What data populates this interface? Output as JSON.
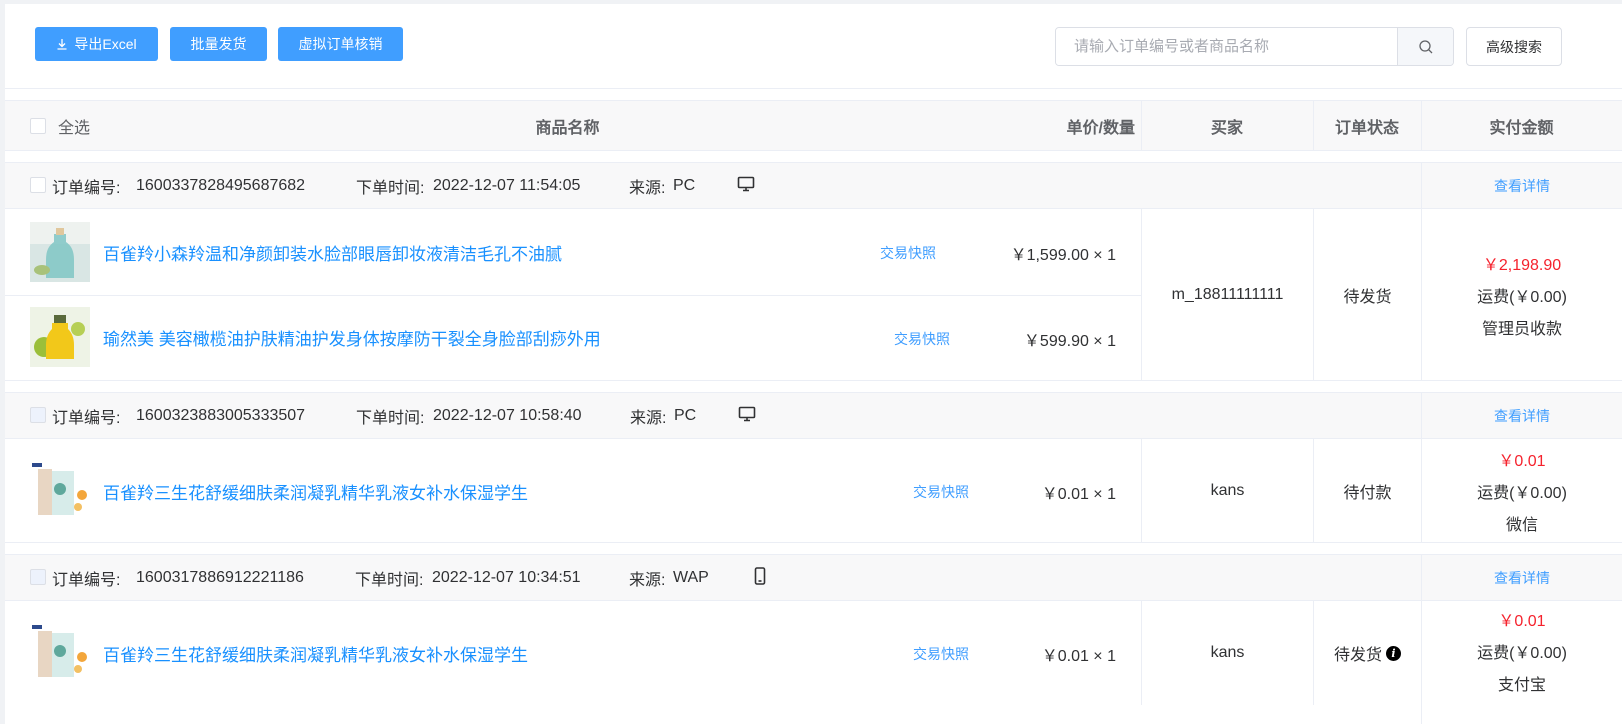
{
  "toolbar": {
    "export_label": "导出Excel",
    "batch_ship_label": "批量发货",
    "virtual_verify_label": "虚拟订单核销",
    "search_placeholder": "请输入订单编号或者商品名称",
    "advanced_search_label": "高级搜索"
  },
  "table_header": {
    "select_all": "全选",
    "product_name": "商品名称",
    "price_qty": "单价/数量",
    "buyer": "买家",
    "order_status": "订单状态",
    "paid_amount": "实付金额"
  },
  "orders": [
    {
      "order_no_label": "订单编号:",
      "order_no": "1600337828495687682",
      "time_label": "下单时间:",
      "time": "2022-12-07 11:54:05",
      "source_label": "来源:",
      "source": "PC",
      "source_icon": "desktop-icon",
      "detail_label": "查看详情",
      "buyer": "m_18811111111",
      "status": "待发货",
      "amount": "￥2,198.90",
      "shipping": "运费(￥0.00)",
      "payment": "管理员收款",
      "items": [
        {
          "name": "百雀羚小森羚温和净颜卸装水脸部眼唇卸妆液清洁毛孔不油腻",
          "snapshot": "交易快照",
          "price_qty": "￥1,599.00 × 1"
        },
        {
          "name": "瑜然美 美容橄榄油护肤精油护发身体按摩防干裂全身脸部刮痧外用",
          "snapshot": "交易快照",
          "price_qty": "￥599.90 × 1"
        }
      ]
    },
    {
      "order_no_label": "订单编号:",
      "order_no": "1600323883005333507",
      "time_label": "下单时间:",
      "time": "2022-12-07 10:58:40",
      "source_label": "来源:",
      "source": "PC",
      "source_icon": "desktop-icon",
      "detail_label": "查看详情",
      "buyer": "kans",
      "status": "待付款",
      "amount": "￥0.01",
      "shipping": "运费(￥0.00)",
      "payment": "微信",
      "items": [
        {
          "name": "百雀羚三生花舒缓细肤柔润凝乳精华乳液女补水保湿学生",
          "snapshot": "交易快照",
          "price_qty": "￥0.01 × 1"
        }
      ]
    },
    {
      "order_no_label": "订单编号:",
      "order_no": "1600317886912221186",
      "time_label": "下单时间:",
      "time": "2022-12-07 10:34:51",
      "source_label": "来源:",
      "source": "WAP",
      "source_icon": "mobile-icon",
      "detail_label": "查看详情",
      "buyer": "kans",
      "status": "待发货",
      "amount": "￥0.01",
      "shipping": "运费(￥0.00)",
      "payment": "支付宝",
      "items": [
        {
          "name": "百雀羚三生花舒缓细肤柔润凝乳精华乳液女补水保湿学生",
          "snapshot": "交易快照",
          "price_qty": "￥0.01 × 1"
        }
      ]
    }
  ],
  "colors": {
    "primary": "#409eff",
    "link": "#1890ff",
    "price": "#f5222d"
  }
}
